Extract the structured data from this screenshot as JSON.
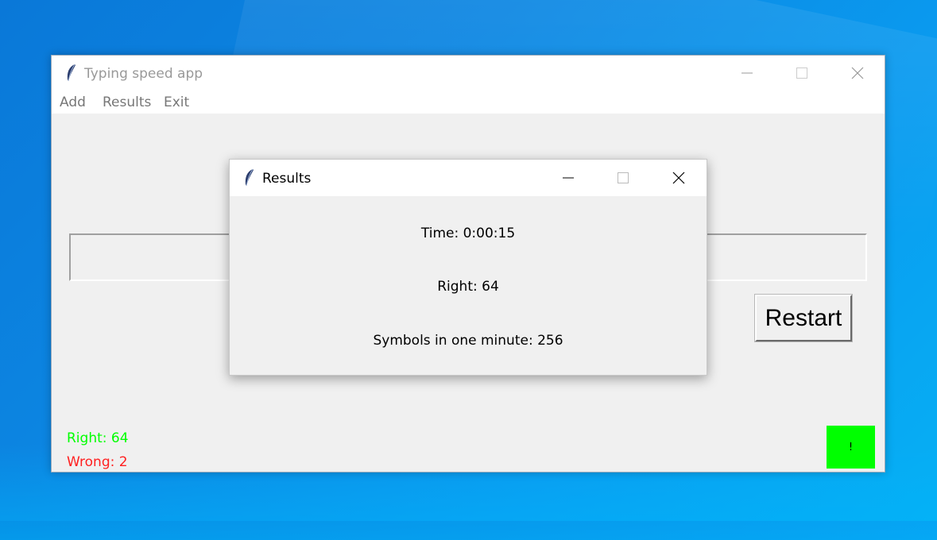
{
  "main_window": {
    "title": "Typing speed app",
    "menu": [
      "Add",
      "Results",
      "Exit"
    ],
    "entry_value": "",
    "restart_label": "Restart",
    "right_label": "Right: 64",
    "wrong_label": "Wrong: 2",
    "indicator_text": "!",
    "indicator_color": "#00ff00"
  },
  "results_window": {
    "title": "Results",
    "time": "Time: 0:00:15",
    "right": "Right: 64",
    "speed": "Symbols in one minute: 256"
  },
  "colors": {
    "right_text": "#00ff00",
    "wrong_text": "#ff2020",
    "desktop": "#0a86e2"
  },
  "icons": [
    "feather-icon",
    "minimize-icon",
    "maximize-icon",
    "close-icon"
  ]
}
